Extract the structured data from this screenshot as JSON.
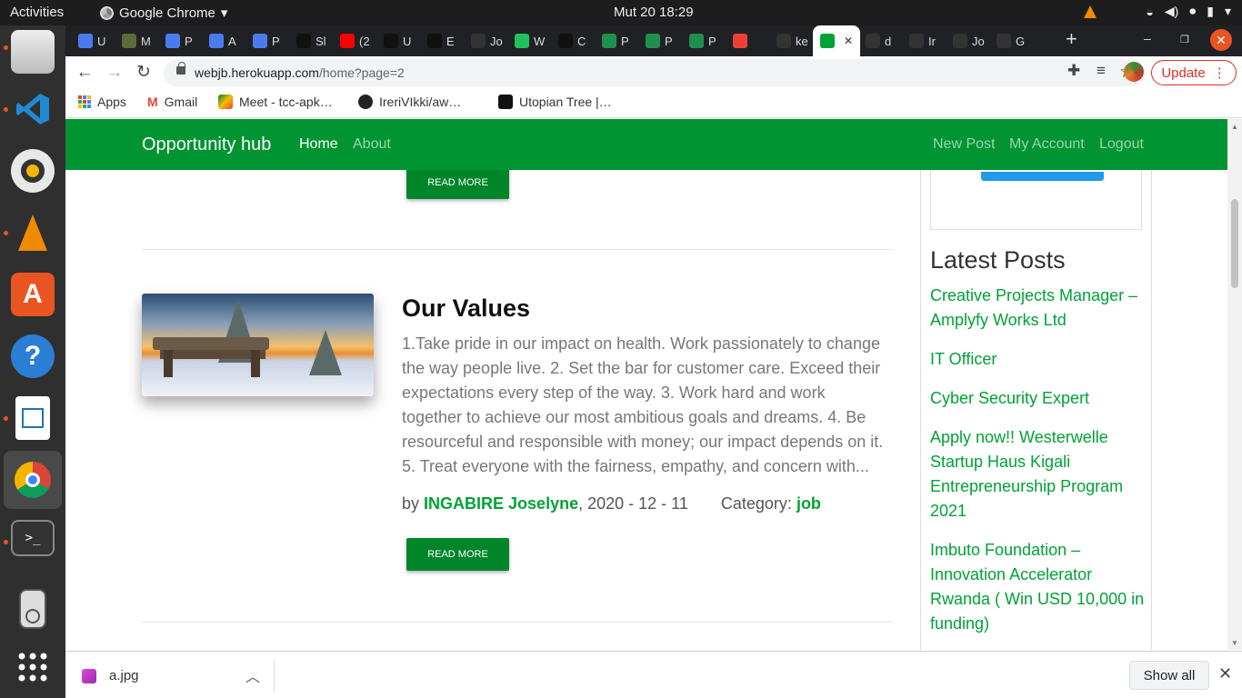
{
  "os": {
    "activities": "Activities",
    "app_name": "Google Chrome",
    "clock": "Mut 20  18:29"
  },
  "tabs": [
    {
      "label": "U",
      "icon": "docs-icon",
      "color": "#4a7cf0"
    },
    {
      "label": "M",
      "icon": "palm-icon",
      "color": "#5b6b3a"
    },
    {
      "label": "P",
      "icon": "docs-icon",
      "color": "#4a7cf0"
    },
    {
      "label": "A",
      "icon": "docs-icon",
      "color": "#4a7cf0"
    },
    {
      "label": "P",
      "icon": "docs-icon",
      "color": "#4a7cf0"
    },
    {
      "label": "Sl",
      "icon": "hashnode-icon",
      "color": "#111111"
    },
    {
      "label": "(2",
      "icon": "youtube-icon",
      "color": "#ff0000"
    },
    {
      "label": "U",
      "icon": "hashnode-icon",
      "color": "#111111"
    },
    {
      "label": "E",
      "icon": "hashnode-icon",
      "color": "#111111"
    },
    {
      "label": "Jo",
      "icon": "github-icon",
      "color": "#333333"
    },
    {
      "label": "W",
      "icon": "play-icon",
      "color": "#21c25e"
    },
    {
      "label": "C",
      "icon": "hashnode-icon",
      "color": "#111111"
    },
    {
      "label": "P",
      "icon": "w-icon",
      "color": "#1f8f4e"
    },
    {
      "label": "P",
      "icon": "w-icon",
      "color": "#1f8f4e"
    },
    {
      "label": "P",
      "icon": "w-icon",
      "color": "#1f8f4e"
    },
    {
      "label": "",
      "icon": "meet-icon",
      "color": "#ea4335"
    },
    {
      "label": "ke",
      "icon": "github-icon",
      "color": "#333333"
    },
    {
      "label": "",
      "icon": "t-icon",
      "color": "#00a236",
      "active": true
    },
    {
      "label": "d",
      "icon": "github-icon",
      "color": "#333333"
    },
    {
      "label": "Ir",
      "icon": "github-icon",
      "color": "#333333"
    },
    {
      "label": "Jo",
      "icon": "github-icon",
      "color": "#333333"
    },
    {
      "label": "G",
      "icon": "github-icon",
      "color": "#333333"
    }
  ],
  "browser": {
    "url_host": "webjb.herokuapp.com",
    "url_path": "/home?page=2",
    "update_label": "Update"
  },
  "bookmarks": [
    {
      "label": "Apps",
      "icon": "apps-grid-icon"
    },
    {
      "label": "Gmail",
      "icon": "gmail-icon"
    },
    {
      "label": "Meet - tcc-apk…",
      "icon": "meet-icon"
    },
    {
      "label": "IreriVIkki/aw…",
      "icon": "github-icon"
    },
    {
      "label": "Utopian Tree |…",
      "icon": "hashnode-icon"
    }
  ],
  "site": {
    "brand": "Opportunity hub",
    "nav_left": [
      "Home",
      "About"
    ],
    "nav_right": [
      "New Post",
      "My Account",
      "Logout"
    ],
    "read_more": "READ MORE"
  },
  "post": {
    "title": "Our Values",
    "excerpt": "1.Take pride in our impact on health. Work passionately to change the way people live. 2. Set the bar for customer care. Exceed their expectations every step of the way. 3. Work hard and work together to achieve our most ambitious goals and dreams. 4. Be resourceful and responsible with money; our impact depends on it. 5. Treat everyone with the fairness, empathy, and concern with...",
    "by": "by",
    "author": "INGABIRE Joselyne",
    "date": ", 2020 - 12 - 11",
    "category_label": "Category:",
    "category": "job"
  },
  "sidebar": {
    "latest_title": "Latest Posts",
    "latest_posts": [
      "Creative Projects Manager – Amplyfy Works Ltd",
      "IT Officer",
      "Cyber Security Expert",
      "Apply now!! Westerwelle Startup Haus Kigali Entrepreneurship Program 2021",
      "Imbuto Foundation – Innovation Accelerator Rwanda ( Win USD 10,000 in funding)"
    ]
  },
  "downloads": {
    "file": "a.jpg",
    "show_all": "Show all"
  },
  "colors": {
    "site_green": "#009432",
    "button_green": "#00852b",
    "link_green": "#00a236",
    "update_red": "#d93025"
  }
}
